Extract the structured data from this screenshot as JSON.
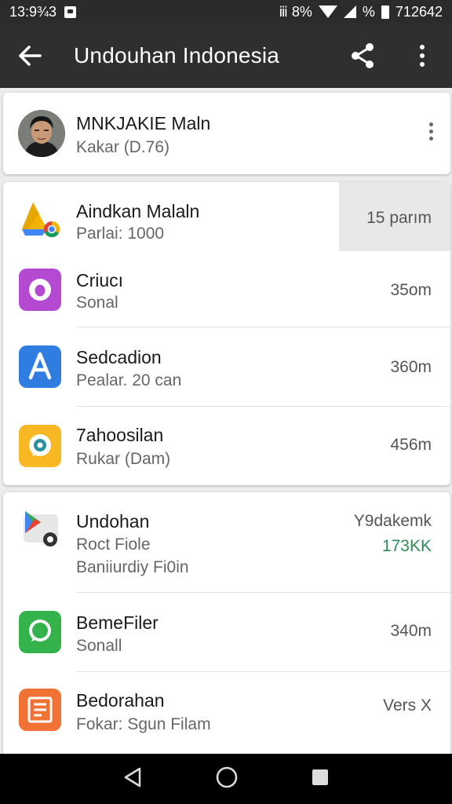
{
  "status_bar": {
    "time": "13:9¾3",
    "right_text_1": "ⅲ 8%",
    "right_text_2": "%",
    "right_text_3": "712642"
  },
  "app_bar": {
    "title": "Undouhan Indonesia"
  },
  "profile": {
    "name": "MNKJAKIE Maln",
    "subtitle": "Kakar (D.76)"
  },
  "group1": [
    {
      "title": "Aindkan Malaln",
      "subtitle": "Parlai: 1000",
      "meta": "15 parım",
      "icon": "drive-chrome-icon"
    },
    {
      "title": "Criucı",
      "subtitle": "Sonal",
      "meta": "35om",
      "icon": "purple-app-icon"
    },
    {
      "title": "Sedcadion",
      "subtitle": "Pealar. 20 can",
      "meta": "360m",
      "icon": "app-store-icon"
    },
    {
      "title": "7ahoosilan",
      "subtitle": "Rukar (Dam)",
      "meta": "456m",
      "icon": "chat-bubble-icon"
    }
  ],
  "group2": [
    {
      "title": "Undohan",
      "subtitle": "Roct Fiole",
      "subtitle2": "Baniiurdiy Fi0in",
      "meta": "Y9dakemk",
      "meta2": "173KK",
      "icon": "play-store-icon"
    },
    {
      "title": "BemeFiler",
      "subtitle": "Sonall",
      "meta": "340m",
      "icon": "message-icon"
    },
    {
      "title": "Bedorahan",
      "subtitle": "Fokar: Sgun Filam",
      "meta": "Vers X",
      "icon": "document-icon"
    }
  ],
  "colors": {
    "status_bar": "#2b2b2b",
    "app_bar": "#2f2f2f",
    "background": "#ececec",
    "highlight": "#e8e8e8",
    "green_text": "#2e8b57",
    "nav_bar": "#000000"
  }
}
